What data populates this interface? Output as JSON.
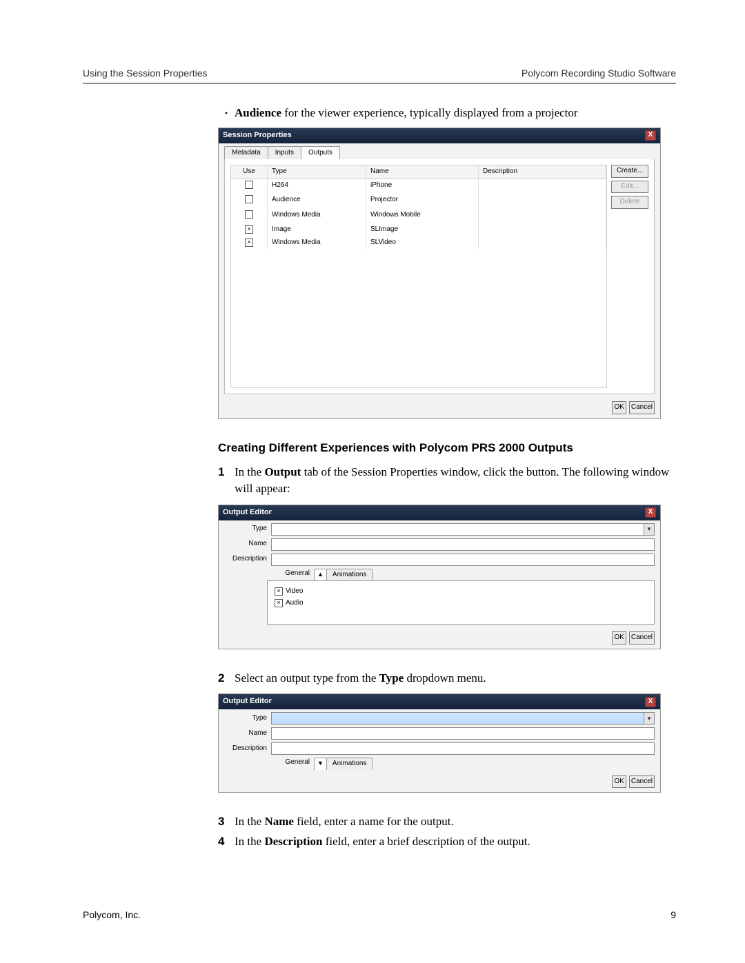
{
  "running_head": {
    "left": "Using the Session Properties",
    "right": "Polycom Recording Studio Software"
  },
  "bullet": {
    "bold": "Audience",
    "rest": " for the viewer experience, typically displayed from a projector"
  },
  "session_properties": {
    "title": "Session Properties",
    "close_label": "X",
    "tabs": [
      "Metadata",
      "Inputs",
      "Outputs"
    ],
    "columns": {
      "use": "Use",
      "type": "Type",
      "name": "Name",
      "description": "Description"
    },
    "rows": [
      {
        "checked": false,
        "type": "H264",
        "name": "iPhone"
      },
      {
        "checked": false,
        "type": "Audience",
        "name": "Projector"
      },
      {
        "checked": false,
        "type": "Windows Media",
        "name": "Windows Mobile"
      },
      {
        "checked": true,
        "type": "Image",
        "name": "SLImage"
      },
      {
        "checked": true,
        "type": "Windows Media",
        "name": "SLVideo"
      }
    ],
    "side_buttons": {
      "create": "Create...",
      "edit": "Edit...",
      "delete": "Delete"
    },
    "footer_buttons": {
      "ok": "OK",
      "cancel": "Cancel"
    }
  },
  "heading2": "Creating Different Experiences with Polycom PRS 2000 Outputs",
  "steps": {
    "s1": {
      "num": "1",
      "pre": "In the ",
      "bold": "Output",
      "post": " tab of the Session Properties window, click the button. The following window will appear:"
    },
    "s2": {
      "num": "2",
      "pre": "Select an output type from the ",
      "bold": "Type",
      "post": " dropdown menu."
    },
    "s3": {
      "num": "3",
      "pre": "In the ",
      "bold": "Name",
      "post": " field, enter a name for the output."
    },
    "s4": {
      "num": "4",
      "pre": "In the ",
      "bold": "Description",
      "post": " field, enter a brief description of the output."
    }
  },
  "output_editor": {
    "title": "Output Editor",
    "labels": {
      "type": "Type",
      "name": "Name",
      "description": "Description",
      "general": "General",
      "animations": "Animations"
    },
    "checks": {
      "video": "Video",
      "audio": "Audio"
    },
    "footer_buttons": {
      "ok": "OK",
      "cancel": "Cancel"
    },
    "arrow_up": "▲",
    "arrow_down": "▼",
    "arrow_select": "▼"
  },
  "footer": {
    "left": "Polycom, Inc.",
    "right": "9"
  }
}
